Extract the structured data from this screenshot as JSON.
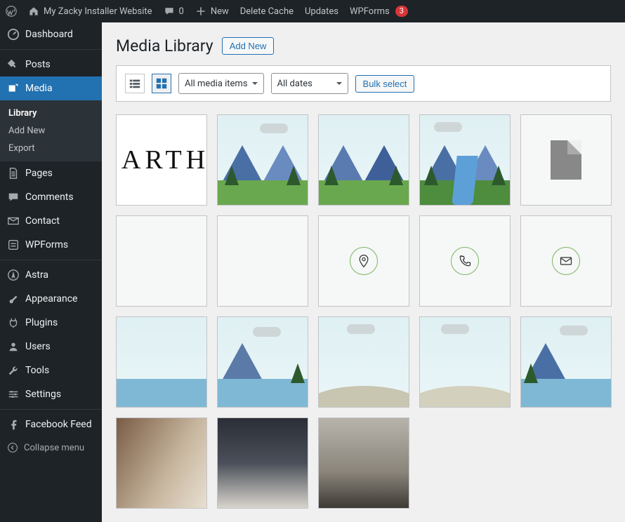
{
  "adminbar": {
    "site_title": "My Zacky Installer Website",
    "comments_count": "0",
    "new_label": "New",
    "delete_cache": "Delete Cache",
    "updates": "Updates",
    "wpforms": "WPForms",
    "wpforms_badge": "3"
  },
  "sidebar": {
    "items": [
      {
        "label": "Dashboard"
      },
      {
        "label": "Posts"
      },
      {
        "label": "Media",
        "current": true
      },
      {
        "label": "Pages"
      },
      {
        "label": "Comments"
      },
      {
        "label": "Contact"
      },
      {
        "label": "WPForms"
      },
      {
        "label": "Astra"
      },
      {
        "label": "Appearance"
      },
      {
        "label": "Plugins"
      },
      {
        "label": "Users"
      },
      {
        "label": "Tools"
      },
      {
        "label": "Settings"
      },
      {
        "label": "Facebook Feed"
      }
    ],
    "submenu": [
      {
        "label": "Library",
        "active": true
      },
      {
        "label": "Add New"
      },
      {
        "label": "Export"
      }
    ],
    "collapse": "Collapse menu"
  },
  "page": {
    "title": "Media Library",
    "add_new": "Add New"
  },
  "toolbar": {
    "filter_type": "All media items",
    "filter_date": "All dates",
    "bulk_select": "Bulk select"
  },
  "tiles": {
    "earth_text": "EARTH"
  }
}
